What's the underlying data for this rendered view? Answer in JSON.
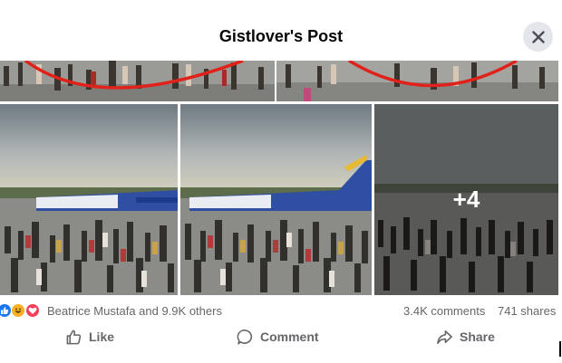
{
  "header": {
    "title": "Gistlover's Post"
  },
  "close": {
    "icon": "close-icon"
  },
  "gallery": {
    "photo_count_visible": 5,
    "more_photos_label": "+4"
  },
  "stats": {
    "reactions": [
      "like",
      "haha",
      "love"
    ],
    "reactor_text": "Beatrice Mustafa and 9.9K others",
    "comments": "3.4K comments",
    "shares": "741 shares"
  },
  "actions": {
    "like_label": "Like",
    "comment_label": "Comment",
    "share_label": "Share"
  },
  "colors": {
    "like_blue": "#1877f2",
    "love_red": "#f33e58",
    "haha_yellow": "#f7b125",
    "secondary_text": "#65676b",
    "close_bg": "#e4e6eb",
    "annotation_red": "#e0221b"
  }
}
